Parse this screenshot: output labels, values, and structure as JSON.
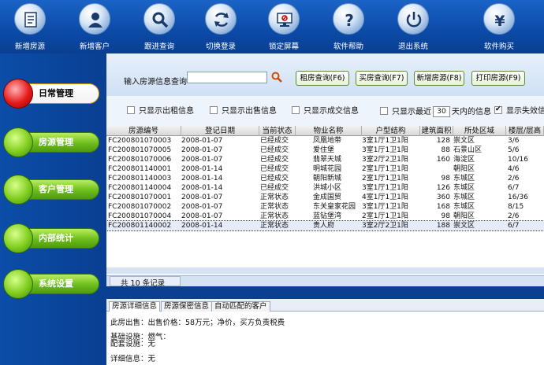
{
  "toolbar": [
    {
      "label": "新增房源",
      "icon": "document-icon"
    },
    {
      "label": "新增客户",
      "icon": "user-icon"
    },
    {
      "label": "跟进查询",
      "icon": "magnifier-icon"
    },
    {
      "label": "切换登录",
      "icon": "refresh-icon"
    },
    {
      "label": "锁定屏幕",
      "icon": "lock-screen-icon"
    },
    {
      "label": "软件帮助",
      "icon": "help-icon"
    },
    {
      "label": "退出系统",
      "icon": "power-icon"
    },
    {
      "label": "软件购买",
      "icon": "yen-icon"
    }
  ],
  "nav": [
    {
      "label": "日常管理",
      "active": true
    },
    {
      "label": "房源管理",
      "active": false
    },
    {
      "label": "客户管理",
      "active": false
    },
    {
      "label": "内部统计",
      "active": false
    },
    {
      "label": "系统设置",
      "active": false
    }
  ],
  "search": {
    "label": "输入房源信息查询",
    "value": "",
    "buttons": [
      "租房查询(F6)",
      "买房查询(F7)",
      "新增房源(F8)",
      "打印房源(F9)"
    ]
  },
  "filters": {
    "rent": "只显示出租信息",
    "sale": "只显示出售信息",
    "done": "只显示成交信息",
    "recent_prefix": "只显示最近",
    "recent_days": "30",
    "recent_suffix": "天内的信息",
    "lapsed": "显示失效信"
  },
  "table": {
    "columns": [
      "房源编号",
      "登记日期",
      "当前状态",
      "物业名称",
      "户型结构",
      "建筑面积",
      "所处区域",
      "楼层/层高"
    ],
    "rows": [
      [
        "FC200801070003",
        "2008-01-07",
        "已经成交",
        "凤凰地带",
        "3室1厅1卫1阳",
        "128",
        "崇文区",
        "3/6"
      ],
      [
        "FC200801070005",
        "2008-01-07",
        "已经成交",
        "爱住堡",
        "3室1厅1卫1阳",
        "88",
        "石景山区",
        "5/6"
      ],
      [
        "FC200801070006",
        "2008-01-07",
        "已经成交",
        "翡翠天城",
        "3室2厅2卫1阳",
        "160",
        "海淀区",
        "10/16"
      ],
      [
        "FC200801140001",
        "2008-01-14",
        "已经成交",
        "明城花园",
        "2室1厅1卫1阳",
        "",
        "朝阳区",
        "4/6"
      ],
      [
        "FC200801140003",
        "2008-01-14",
        "已经成交",
        "朝阳新城",
        "2室1厅1卫1阳",
        "98",
        "东城区",
        "2/6"
      ],
      [
        "FC200801140004",
        "2008-01-14",
        "已经成交",
        "洪城小区",
        "3室1厅1卫1阳",
        "126",
        "东城区",
        "6/7"
      ],
      [
        "FC200801070001",
        "2008-01-07",
        "正常状态",
        "金成国贸",
        "4室1厅1卫1阳",
        "360",
        "东城区",
        "16/36"
      ],
      [
        "FC200801070002",
        "2008-01-07",
        "正常状态",
        "东关皇家花园",
        "3室1厅1卫1阳",
        "168",
        "东城区",
        "8/15"
      ],
      [
        "FC200801070004",
        "2008-01-07",
        "正常状态",
        "蓝钻堡湾",
        "2室1厅1卫1阳",
        "98",
        "朝阳区",
        "2/6"
      ],
      [
        "FC200801140002",
        "2008-01-14",
        "正常状态",
        "贵人府",
        "3室2厅2卫1阳",
        "188",
        "崇文区",
        "6/7"
      ]
    ],
    "selected_row": 9
  },
  "status": {
    "count_text": "共 10 条记录"
  },
  "detail_tabs": [
    "房源详细信息",
    "房源保密信息",
    "自动匹配的客户"
  ],
  "detail": {
    "line1": "此房出售：出售价格：58万元；净价，买方负责税费",
    "line2": "基础设施：燃气：",
    "line3": "配套设施：无",
    "line4": "详细信息：无"
  }
}
